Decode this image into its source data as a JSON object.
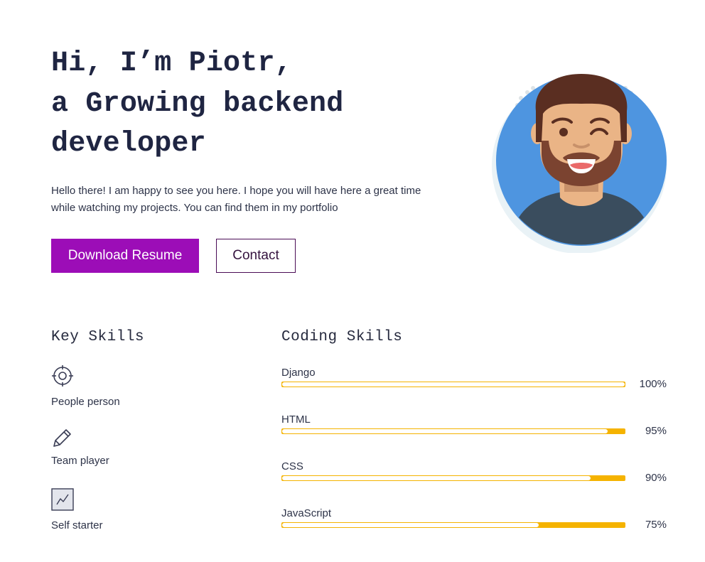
{
  "hero": {
    "heading_lines": [
      "Hi, I’m Piotr,",
      "a Growing backend",
      "developer"
    ],
    "intro_lines": [
      "Hello there! I am happy to see you here. I hope you will have here a great time",
      "while watching my projects. You can find them in my portfolio"
    ],
    "download_label": "Download Resume",
    "contact_label": "Contact"
  },
  "key_skills": {
    "title": "Key Skills",
    "items": [
      {
        "label": "People person",
        "icon": "target-icon"
      },
      {
        "label": "Team player",
        "icon": "pencil-icon"
      },
      {
        "label": "Self starter",
        "icon": "trend-chart-icon"
      }
    ]
  },
  "coding_skills": {
    "title": "Coding Skills",
    "items": [
      {
        "name": "Django",
        "percent": 100,
        "percent_label": "100%"
      },
      {
        "name": "HTML",
        "percent": 95,
        "percent_label": "95%"
      },
      {
        "name": "CSS",
        "percent": 90,
        "percent_label": "90%"
      },
      {
        "name": "JavaScript",
        "percent": 75,
        "percent_label": "75%"
      }
    ]
  },
  "colors": {
    "accent": "#9c0db7",
    "heading": "#1f2542",
    "bar": "#f5b300",
    "avatar_bg": "#4e95e0"
  }
}
